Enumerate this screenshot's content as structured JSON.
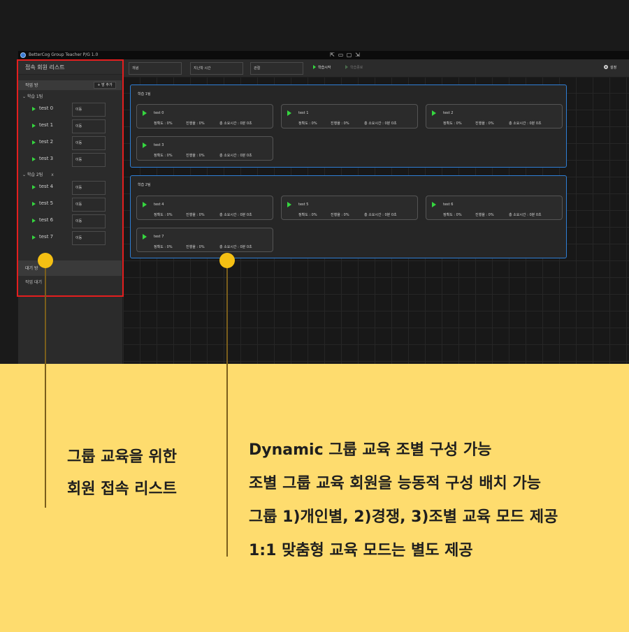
{
  "app": {
    "title": "BetterCog Group Teacher P/G 1.0",
    "window_controls": [
      "⇱",
      "▭",
      "▢",
      "⇲"
    ]
  },
  "sidebar": {
    "title": "접속 회원 리스트",
    "working_section": "작업 방",
    "add_button": "+ 방 추가",
    "groups": [
      {
        "label": "⌄  학습 1팀",
        "close": "",
        "members": [
          "test 0",
          "test 1",
          "test 2",
          "test 3"
        ]
      },
      {
        "label": "⌄  학습 2팀",
        "close": "x",
        "members": [
          "test 4",
          "test 5",
          "test 6",
          "test 7"
        ]
      }
    ],
    "move_label": "이동",
    "waiting_section": "대기 방",
    "waiting_item": "작업 대기"
  },
  "toolbar": {
    "fields": [
      "개념",
      "지난학 시간",
      "관절"
    ],
    "start_button": "학습시작",
    "stop_button": "학습종료",
    "settings_button": "설정"
  },
  "groups": [
    {
      "title": "학습 1팀",
      "cards": [
        {
          "name": "test 0",
          "accuracy": "정확도 : 0%",
          "progress": "진행율 : 0%",
          "time": "총 소요시간 : 0분 0초"
        },
        {
          "name": "test 1",
          "accuracy": "정확도 : 0%",
          "progress": "진행율 : 0%",
          "time": "총 소요시간 : 0분 0초"
        },
        {
          "name": "test 2",
          "accuracy": "정확도 : 0%",
          "progress": "진행율 : 0%",
          "time": "총 소요시간 : 0분 0초"
        },
        {
          "name": "test 3",
          "accuracy": "정확도 : 0%",
          "progress": "진행율 : 0%",
          "time": "총 소요시간 : 0분 0초"
        }
      ]
    },
    {
      "title": "학습 2팀",
      "cards": [
        {
          "name": "test 4",
          "accuracy": "정확도 : 0%",
          "progress": "진행율 : 0%",
          "time": "총 소요시간 : 0분 0초"
        },
        {
          "name": "test 5",
          "accuracy": "정확도 : 0%",
          "progress": "진행율 : 0%",
          "time": "총 소요시간 : 0분 0초"
        },
        {
          "name": "test 6",
          "accuracy": "정확도 : 0%",
          "progress": "진행율 : 0%",
          "time": "총 소요시간 : 0분 0초"
        },
        {
          "name": "test 7",
          "accuracy": "정확도 : 0%",
          "progress": "진행율 : 0%",
          "time": "총 소요시간 : 0분 0초"
        }
      ]
    }
  ],
  "captions": {
    "left": [
      "그룹 교육을 위한",
      "회원 접속 리스트"
    ],
    "right": [
      "Dynamic 그룹 교육 조별 구성 가능",
      "조별 그룹 교육 회원을 능동적 구성 배치 가능",
      "그룹 1)개인별, 2)경쟁, 3)조별 교육 모드 제공",
      "1:1 맞춤형 교육 모드는 별도 제공"
    ]
  },
  "colors": {
    "highlight_frame": "#e41e1e",
    "group_border": "#2f7fd6",
    "play_icon": "#35d63f",
    "callout": "#f5c013",
    "panel_background": "#fedc6e"
  }
}
